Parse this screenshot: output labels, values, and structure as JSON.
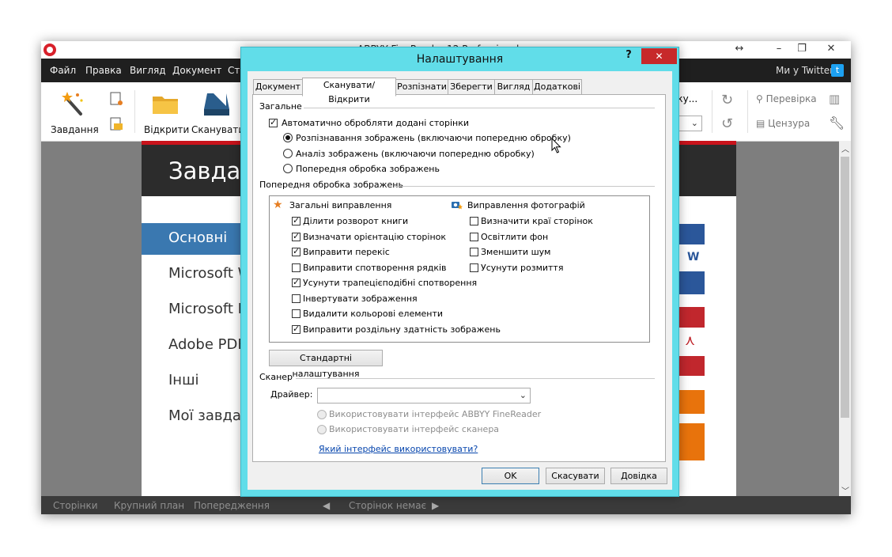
{
  "app": {
    "title": "ABBYY FineReader 12 Professional",
    "window_buttons": {
      "resize": "↔",
      "minimize": "–",
      "restore": "❐",
      "close": "✕"
    },
    "menu": [
      "Файл",
      "Правка",
      "Вигляд",
      "Документ",
      "Сто"
    ],
    "twitter_label": "Ми у Twitter:",
    "twitter_glyph": "t",
    "toolbar": {
      "tasks": "Завдання",
      "open": "Відкрити",
      "scan": "Сканувати",
      "doc_partial": "оку...",
      "verify": "Перевірка",
      "censor": "Цензура"
    },
    "content": {
      "header": "Завдан",
      "nav": [
        "Основні",
        "Microsoft W",
        "Microsoft Ex",
        "Adobe PDF",
        "Інші",
        "Мої завдан"
      ],
      "word_tile_letter": "W"
    },
    "statusbar": {
      "pages": "Сторінки",
      "zoom": "Крупний план",
      "warnings": "Попередження",
      "no_pages": "Сторінок немає",
      "prev": "◀",
      "next": "▶"
    }
  },
  "dialog": {
    "title": "Налаштування",
    "help": "?",
    "close": "✕",
    "tabs": [
      "Документ",
      "Сканувати/Відкрити",
      "Розпізнати",
      "Зберегти",
      "Вигляд",
      "Додаткові"
    ],
    "active_tab": "Сканувати/Відкрити",
    "general": {
      "title": "Загальне",
      "auto_process_label": "Автоматично обробляти додані сторінки",
      "auto_process_checked": true,
      "radios": [
        {
          "label": "Розпізнавання зображень (включаючи попередню обробку)",
          "selected": true
        },
        {
          "label": "Аналіз зображень (включаючи попередню обробку)",
          "selected": false
        },
        {
          "label": "Попередня обробка зображень",
          "selected": false
        }
      ]
    },
    "preprocess": {
      "title": "Попередня обробка зображень",
      "general_fixes": {
        "title": "Загальні виправлення",
        "items": [
          {
            "label": "Ділити розворот книги",
            "checked": true
          },
          {
            "label": "Визначати орієнтацію сторінок",
            "checked": true
          },
          {
            "label": "Виправити перекіс",
            "checked": true
          },
          {
            "label": "Виправити спотворення рядків",
            "checked": false
          },
          {
            "label": "Усунути трапецієподібні спотворення",
            "checked": true
          },
          {
            "label": "Інвертувати зображення",
            "checked": false
          },
          {
            "label": "Видалити кольорові елементи",
            "checked": false
          },
          {
            "label": "Виправити роздільну здатність зображень",
            "checked": true
          }
        ]
      },
      "photo_fixes": {
        "title": "Виправлення фотографій",
        "items": [
          {
            "label": "Визначити краї сторінок",
            "checked": false
          },
          {
            "label": "Освітлити фон",
            "checked": false
          },
          {
            "label": "Зменшити шум",
            "checked": false
          },
          {
            "label": "Усунути розмиття",
            "checked": false
          }
        ]
      },
      "defaults_button": "Стандартні налаштування"
    },
    "scanner": {
      "title": "Сканер",
      "driver_label": "Драйвер:",
      "driver_value": "",
      "radios": [
        {
          "label": "Використовувати інтерфейс ABBYY FineReader",
          "selected": false
        },
        {
          "label": "Використовувати інтерфейс сканера",
          "selected": false
        }
      ],
      "which_interface_link": "Який інтерфейс використовувати?"
    },
    "buttons": {
      "ok": "OK",
      "cancel": "Скасувати",
      "help": "Довідка"
    }
  },
  "colors": {
    "dialog_frame": "#61dde9",
    "close_red": "#c7292a",
    "nav_active": "#3a78b0",
    "content_header": "#2c2c2c",
    "accent_red": "#c9131b",
    "word_blue": "#2b579a",
    "pdf_red": "#c1272d",
    "orange": "#e8730c"
  },
  "icons": {
    "general_fixes": "star-icon",
    "photo_fixes": "camera-star-icon",
    "mouse": "cursor-icon"
  }
}
